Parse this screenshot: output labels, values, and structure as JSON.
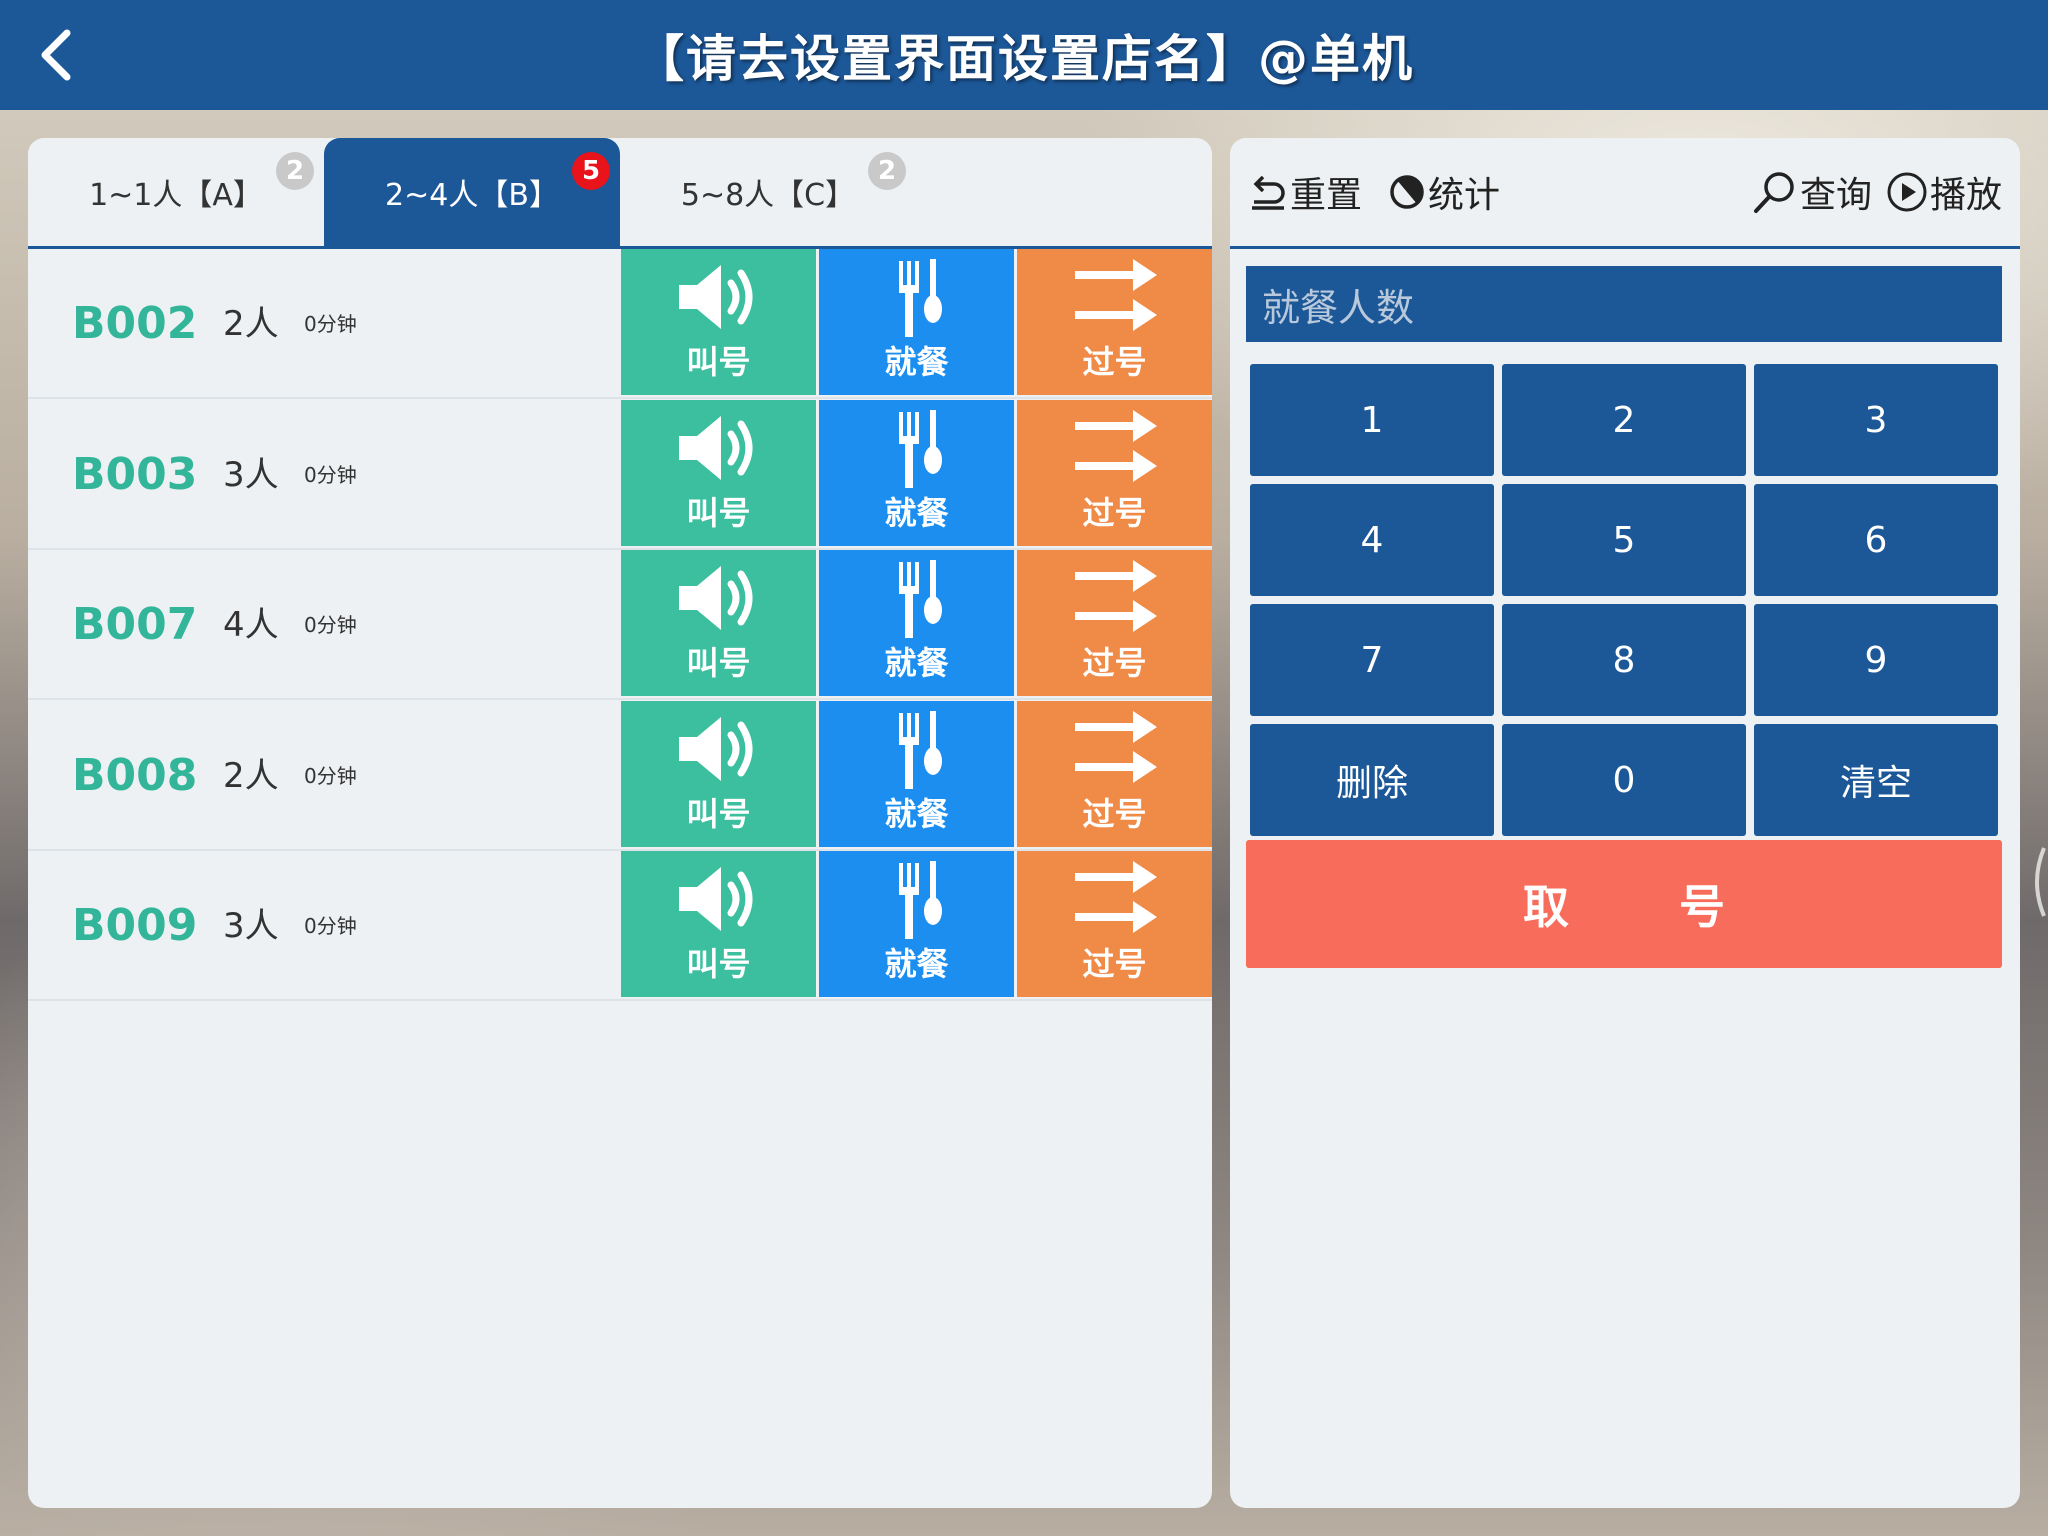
{
  "header": {
    "title": "【请去设置界面设置店名】@单机",
    "back_icon": "chevron-left-icon"
  },
  "tabs": [
    {
      "label": "1~1人【A】",
      "badge": "2",
      "badge_color": "#c9c9c9",
      "active": false
    },
    {
      "label": "2~4人【B】",
      "badge": "5",
      "badge_color": "#e8131b",
      "active": true
    },
    {
      "label": "5~8人【C】",
      "badge": "2",
      "badge_color": "#c9c9c9",
      "active": false
    }
  ],
  "queue": [
    {
      "ticket": "B002",
      "people": "2人",
      "wait": "0分钟"
    },
    {
      "ticket": "B003",
      "people": "3人",
      "wait": "0分钟"
    },
    {
      "ticket": "B007",
      "people": "4人",
      "wait": "0分钟"
    },
    {
      "ticket": "B008",
      "people": "2人",
      "wait": "0分钟"
    },
    {
      "ticket": "B009",
      "people": "3人",
      "wait": "0分钟"
    }
  ],
  "actions": {
    "call": "叫号",
    "dine": "就餐",
    "skip": "过号"
  },
  "toolbar": {
    "reset": "重置",
    "stats": "统计",
    "query": "查询",
    "play": "播放"
  },
  "input": {
    "placeholder": "就餐人数"
  },
  "keypad": [
    "1",
    "2",
    "3",
    "4",
    "5",
    "6",
    "7",
    "8",
    "9",
    "删除",
    "0",
    "清空"
  ],
  "take_ticket": "取号",
  "colors": {
    "primary": "#1c5797",
    "call": "#3bbf9e",
    "dine": "#1b8ef0",
    "skip": "#ef8a47",
    "take": "#f76c5a",
    "ticket_text": "#33b59a"
  }
}
